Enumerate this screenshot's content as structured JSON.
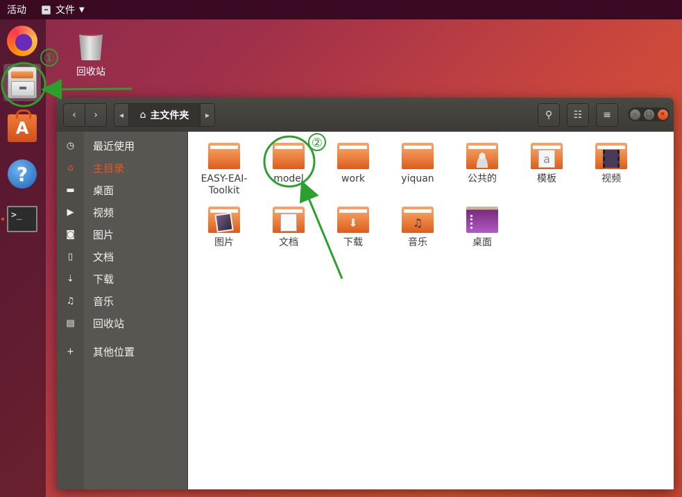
{
  "topbar": {
    "activities": "活动",
    "app_menu": "文件"
  },
  "dock": {
    "items": [
      {
        "name": "firefox"
      },
      {
        "name": "files",
        "active": true
      },
      {
        "name": "software"
      },
      {
        "name": "help"
      },
      {
        "name": "terminal",
        "running": true
      }
    ]
  },
  "desktop": {
    "trash_label": "回收站"
  },
  "window": {
    "breadcrumb": "主文件夹",
    "sidebar": [
      {
        "label": "最近使用",
        "icon": "clock-icon",
        "glyph": "◷"
      },
      {
        "label": "主目录",
        "icon": "home-icon",
        "glyph": "⌂"
      },
      {
        "label": "桌面",
        "icon": "folder-icon",
        "glyph": "▬"
      },
      {
        "label": "视频",
        "icon": "video-icon",
        "glyph": "▶"
      },
      {
        "label": "图片",
        "icon": "camera-icon",
        "glyph": "◙"
      },
      {
        "label": "文档",
        "icon": "document-icon",
        "glyph": "▯"
      },
      {
        "label": "下载",
        "icon": "download-icon",
        "glyph": "⇣"
      },
      {
        "label": "音乐",
        "icon": "music-icon",
        "glyph": "♫"
      },
      {
        "label": "回收站",
        "icon": "trash-icon",
        "glyph": "▤"
      },
      {
        "label": "其他位置",
        "icon": "plus-icon",
        "glyph": "+"
      }
    ],
    "files": [
      {
        "label": "EASY-EAI-Toolkit",
        "line1": "EASY-EAI-",
        "line2": "Toolkit"
      },
      {
        "label": "model"
      },
      {
        "label": "work"
      },
      {
        "label": "yiquan"
      },
      {
        "label": "公共的"
      },
      {
        "label": "模板"
      },
      {
        "label": "视频"
      },
      {
        "label": "图片"
      },
      {
        "label": "文档"
      },
      {
        "label": "下载"
      },
      {
        "label": "音乐"
      },
      {
        "label": "桌面"
      }
    ]
  },
  "annotations": {
    "marker1": "①",
    "marker2": "②",
    "color": "#2ca02c"
  }
}
